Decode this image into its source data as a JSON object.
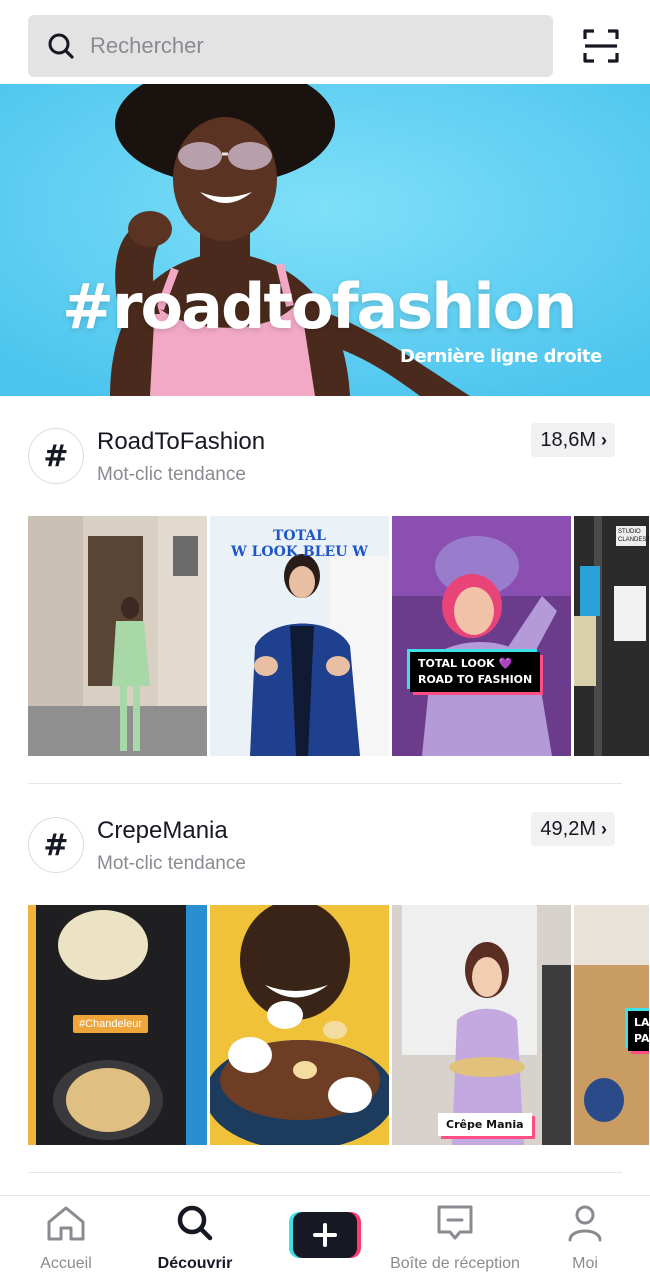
{
  "search": {
    "placeholder": "Rechercher"
  },
  "banner": {
    "title": "#roadtofashion",
    "subtitle": "Dernière ligne droite",
    "dots_count": 5,
    "active_dot": 1
  },
  "trends": [
    {
      "tag": "RoadToFashion",
      "type": "Mot-clic tendance",
      "count": "18,6M",
      "thumbs": [
        {
          "labels": []
        },
        {
          "labels": [
            "TOTAL",
            "W LOOK BLEU W"
          ]
        },
        {
          "labels": [
            "TOTAL LOOK 💜",
            "ROAD TO FASHION"
          ]
        },
        {
          "labels": [
            "STUDIO CLANDESTIN"
          ]
        }
      ]
    },
    {
      "tag": "CrepeMania",
      "type": "Mot-clic tendance",
      "count": "49,2M",
      "thumbs": [
        {
          "labels": [
            "#Chandeleur"
          ]
        },
        {
          "labels": []
        },
        {
          "labels": [
            "Crêpe Mania"
          ]
        },
        {
          "labels": [
            "LA",
            "PA"
          ]
        }
      ]
    }
  ],
  "nav": {
    "home": "Accueil",
    "discover": "Découvrir",
    "inbox": "Boîte de réception",
    "me": "Moi"
  },
  "colors": {
    "accent_cyan": "#3ee0e6",
    "accent_pink": "#ff4d86",
    "banner_blue": "#5ccdf1",
    "text_primary": "#161823",
    "text_secondary": "#8a8b91"
  }
}
